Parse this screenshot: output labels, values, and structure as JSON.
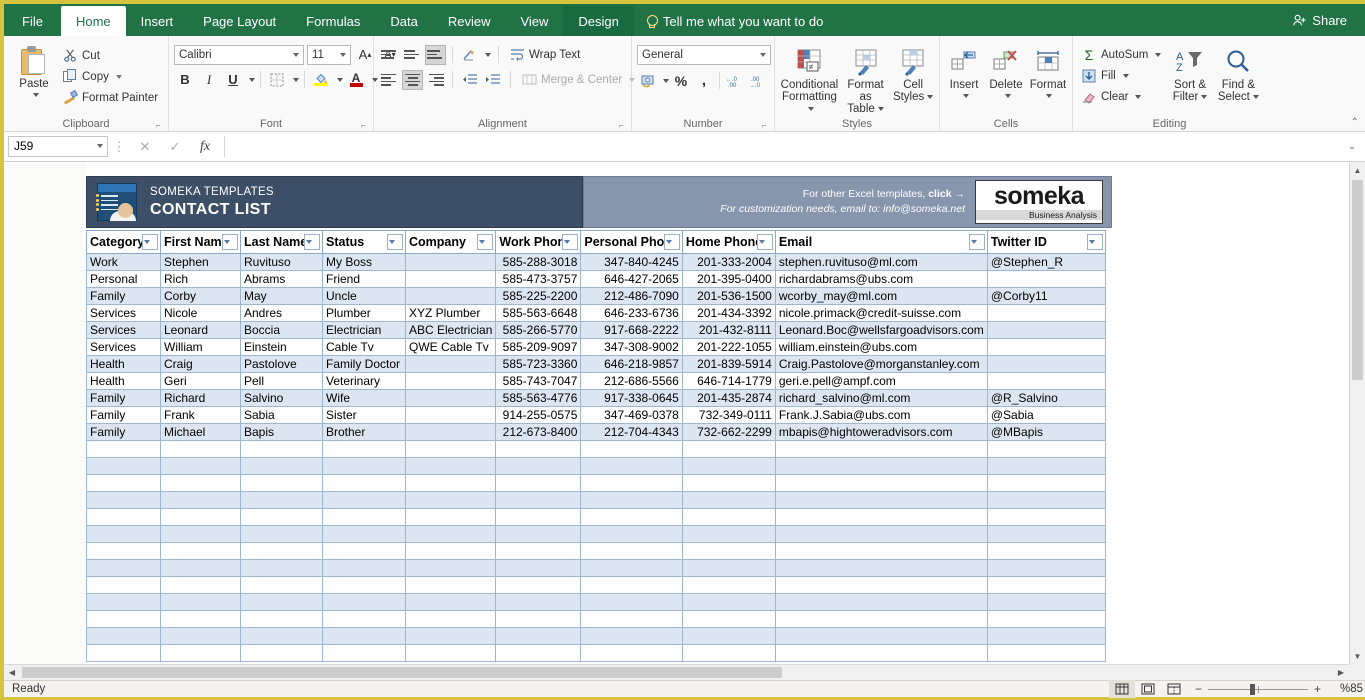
{
  "window": {
    "tabs": [
      "File",
      "Home",
      "Insert",
      "Page Layout",
      "Formulas",
      "Data",
      "Review",
      "View",
      "Design"
    ],
    "active_tab": "Home",
    "tell_me": "Tell me what you want to do",
    "share_label": "Share"
  },
  "ribbon": {
    "clipboard": {
      "group_label": "Clipboard",
      "paste": "Paste",
      "cut": "Cut",
      "copy": "Copy",
      "format_painter": "Format Painter"
    },
    "font": {
      "group_label": "Font",
      "font_name": "Calibri",
      "font_size": "11",
      "bold": "B",
      "italic": "I",
      "underline": "U"
    },
    "alignment": {
      "group_label": "Alignment",
      "wrap_text": "Wrap Text",
      "merge_center": "Merge & Center"
    },
    "number": {
      "group_label": "Number",
      "format": "General",
      "percent": "%",
      "comma": ","
    },
    "styles": {
      "group_label": "Styles",
      "conditional_formatting": "Conditional\nFormatting",
      "conditional_formatting_l1": "Conditional",
      "conditional_formatting_l2": "Formatting",
      "format_as_table_l1": "Format as",
      "format_as_table_l2": "Table",
      "cell_styles_l1": "Cell",
      "cell_styles_l2": "Styles"
    },
    "cells": {
      "group_label": "Cells",
      "insert": "Insert",
      "delete": "Delete",
      "format": "Format"
    },
    "editing": {
      "group_label": "Editing",
      "autosum": "AutoSum",
      "fill": "Fill",
      "clear": "Clear",
      "sort_filter_l1": "Sort &",
      "sort_filter_l2": "Filter",
      "find_select_l1": "Find &",
      "find_select_l2": "Select"
    }
  },
  "formula_bar": {
    "name_box": "J59",
    "formula_value": "",
    "cancel_icon": "✕",
    "confirm_icon": "✓",
    "function_icon": "fx"
  },
  "banner": {
    "brand_line": "SOMEKA TEMPLATES",
    "title": "CONTACT LIST",
    "promo_line1_a": "For other Excel templates, ",
    "promo_line1_b": "click →",
    "promo_line2": "For customization needs, email to: info@someka.net",
    "logo_word": "someka",
    "logo_sub": "Business Analysis"
  },
  "table": {
    "headers": [
      "Category",
      "First Name",
      "Last Name",
      "Status",
      "Company",
      "Work Phone",
      "Personal Phone",
      "Home Phone",
      "Email",
      "Twitter ID"
    ],
    "rows": [
      [
        "Work",
        "Stephen",
        "Ruvituso",
        "My Boss",
        "",
        "585-288-3018",
        "347-840-4245",
        "201-333-2004",
        "stephen.ruvituso@ml.com",
        "@Stephen_R"
      ],
      [
        "Personal",
        "Rich",
        "Abrams",
        "Friend",
        "",
        "585-473-3757",
        "646-427-2065",
        "201-395-0400",
        "richardabrams@ubs.com",
        ""
      ],
      [
        "Family",
        "Corby",
        "May",
        "Uncle",
        "",
        "585-225-2200",
        "212-486-7090",
        "201-536-1500",
        "wcorby_may@ml.com",
        "@Corby11"
      ],
      [
        "Services",
        "Nicole",
        "Andres",
        "Plumber",
        "XYZ Plumber",
        "585-563-6648",
        "646-233-6736",
        "201-434-3392",
        "nicole.primack@credit-suisse.com",
        ""
      ],
      [
        "Services",
        "Leonard",
        "Boccia",
        "Electrician",
        "ABC Electrician",
        "585-266-5770",
        "917-668-2222",
        "201-432-8111",
        "Leonard.Boc@wellsfargoadvisors.com",
        ""
      ],
      [
        "Services",
        "William",
        "Einstein",
        "Cable Tv",
        "QWE Cable Tv",
        "585-209-9097",
        "347-308-9002",
        "201-222-1055",
        "william.einstein@ubs.com",
        ""
      ],
      [
        "Health",
        "Craig",
        "Pastolove",
        "Family Doctor",
        "",
        "585-723-3360",
        "646-218-9857",
        "201-839-5914",
        "Craig.Pastolove@morganstanley.com",
        ""
      ],
      [
        "Health",
        "Geri",
        "Pell",
        "Veterinary",
        "",
        "585-743-7047",
        "212-686-5566",
        "646-714-1779",
        "geri.e.pell@ampf.com",
        ""
      ],
      [
        "Family",
        "Richard",
        "Salvino",
        "Wife",
        "",
        "585-563-4776",
        "917-338-0645",
        "201-435-2874",
        "richard_salvino@ml.com",
        "@R_Salvino"
      ],
      [
        "Family",
        "Frank",
        "Sabia",
        "Sister",
        "",
        "914-255-0575",
        "347-469-0378",
        "732-349-0111",
        "Frank.J.Sabia@ubs.com",
        "@Sabia"
      ],
      [
        "Family",
        "Michael",
        "Bapis",
        "Brother",
        "",
        "212-673-8400",
        "212-704-4343",
        "732-662-2299",
        "mbapis@hightoweradvisors.com",
        "@MBapis"
      ]
    ],
    "empty_row_count": 13
  },
  "status_bar": {
    "state": "Ready",
    "zoom": "%85"
  },
  "colors": {
    "excel_green": "#217346",
    "accent_yellow": "#d6c43f",
    "banner_dark": "#3d4f66",
    "banner_light": "#8795ad",
    "row_alt": "#dce6f2"
  }
}
